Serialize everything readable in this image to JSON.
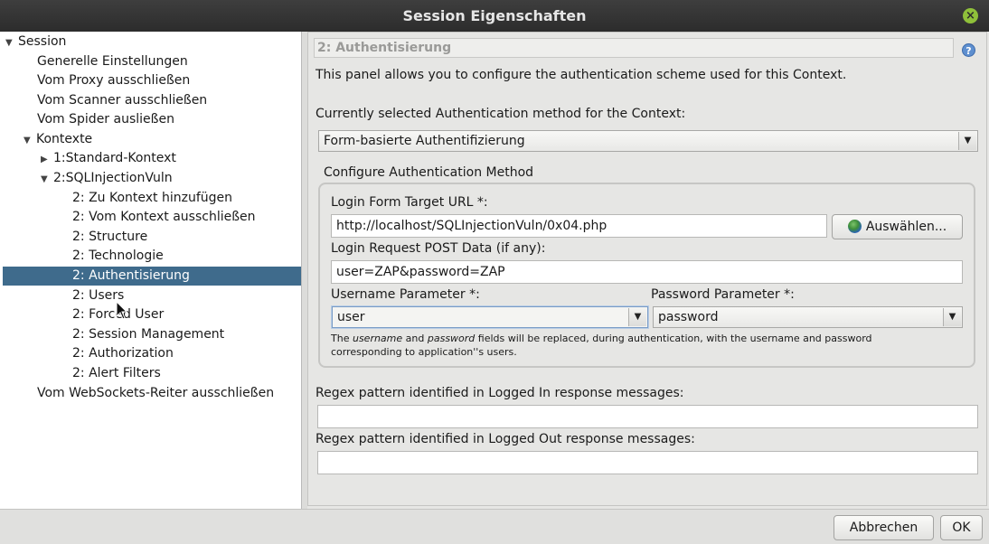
{
  "window": {
    "title": "Session Eigenschaften"
  },
  "tree": {
    "items": [
      {
        "label": "Session",
        "toggle": "▼"
      },
      {
        "label": "Generelle Einstellungen"
      },
      {
        "label": "Vom Proxy ausschließen"
      },
      {
        "label": "Vom Scanner ausschließen"
      },
      {
        "label": "Vom Spider ausließen"
      },
      {
        "label": "Kontexte",
        "toggle": "▼"
      },
      {
        "label": "1:Standard-Kontext",
        "toggle": "▶"
      },
      {
        "label": "2:SQLInjectionVuln",
        "toggle": "▼"
      },
      {
        "label": "2: Zu Kontext hinzufügen"
      },
      {
        "label": "2: Vom Kontext ausschließen"
      },
      {
        "label": "2: Structure"
      },
      {
        "label": "2: Technologie"
      },
      {
        "label": "2: Authentisierung"
      },
      {
        "label": "2: Users"
      },
      {
        "label": "2: Forced User"
      },
      {
        "label": "2: Session Management"
      },
      {
        "label": "2: Authorization"
      },
      {
        "label": "2: Alert Filters"
      },
      {
        "label": "Vom WebSockets-Reiter ausschließen"
      }
    ]
  },
  "panel": {
    "title": "2: Authentisierung",
    "description": "This panel allows you to configure the authentication scheme used for this Context.",
    "method_label": "Currently selected Authentication method for the Context:",
    "method_value": "Form-basierte Authentifizierung",
    "group_label": "Configure Authentication Method",
    "login_url_label": "Login Form Target URL *:",
    "login_url_value": "http://localhost/SQLInjectionVuln/0x04.php",
    "select_button": "Auswählen...",
    "post_data_label": "Login Request POST Data (if any):",
    "post_data_value": "user=ZAP&password=ZAP",
    "username_param_label": "Username Parameter *:",
    "username_param_value": "user",
    "password_param_label": "Password Parameter *:",
    "password_param_value": "password",
    "note_line1_a": "The ",
    "note_line1_b": "username",
    "note_line1_c": " and ",
    "note_line1_d": "password",
    "note_line1_e": " fields will be replaced, during authentication, with the username and password",
    "note_line2": "corresponding to application''s users.",
    "logged_in_label": "Regex pattern identified in Logged In response messages:",
    "logged_in_value": "",
    "logged_out_label": "Regex pattern identified in Logged Out response messages:",
    "logged_out_value": ""
  },
  "footer": {
    "cancel": "Abbrechen",
    "ok": "OK"
  },
  "colors": {
    "titlebar": "#2c2c2c",
    "selection": "#3f6b8c",
    "close": "#8fc03a"
  }
}
